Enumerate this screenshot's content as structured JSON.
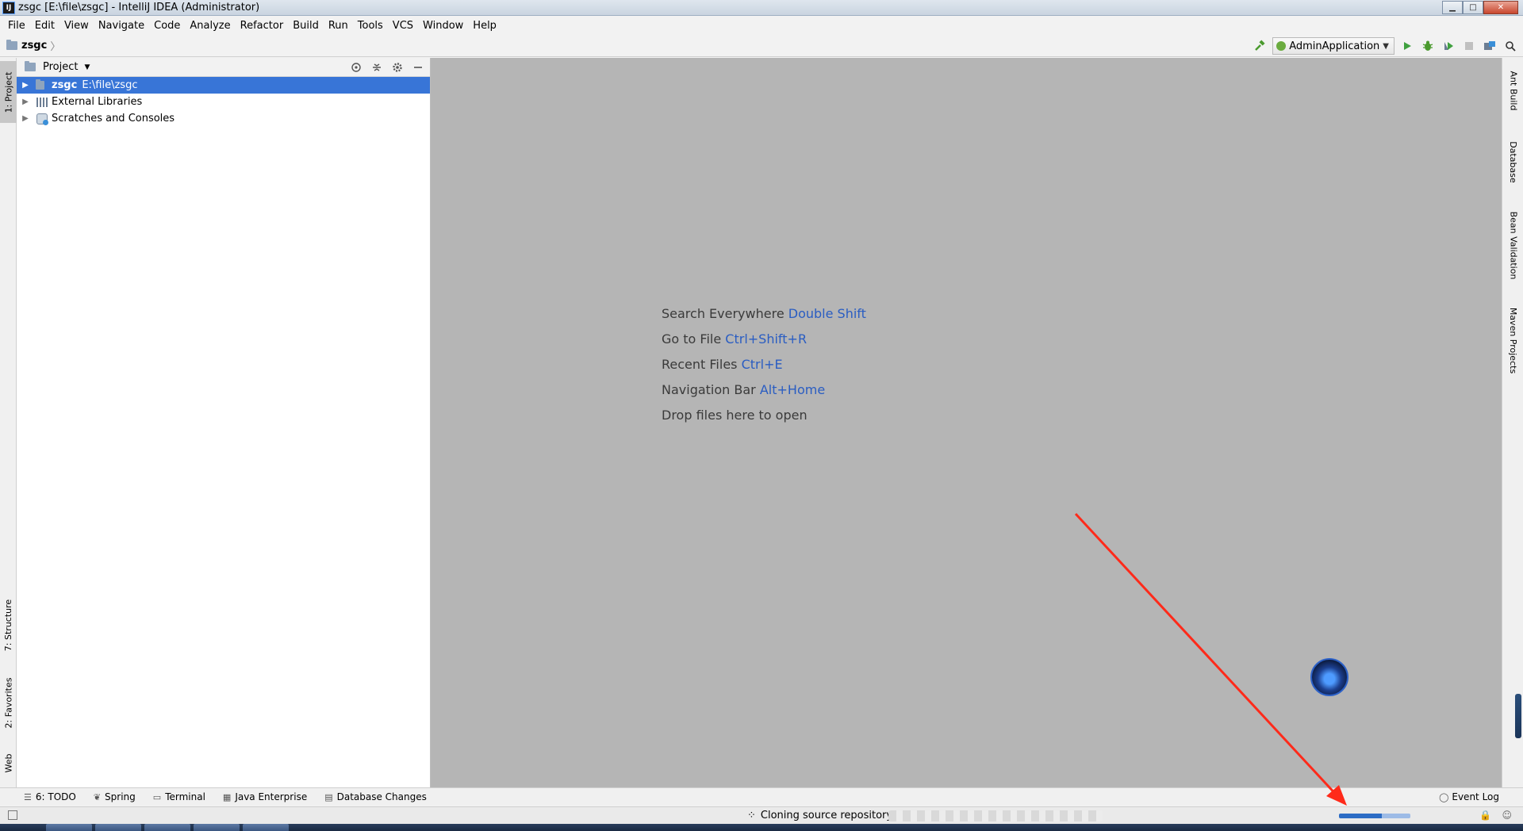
{
  "window": {
    "title": "zsgc [E:\\file\\zsgc] - IntelliJ IDEA (Administrator)",
    "app_icon": "IJ"
  },
  "menu": [
    {
      "label": "File"
    },
    {
      "label": "Edit"
    },
    {
      "label": "View"
    },
    {
      "label": "Navigate"
    },
    {
      "label": "Code"
    },
    {
      "label": "Analyze"
    },
    {
      "label": "Refactor"
    },
    {
      "label": "Build"
    },
    {
      "label": "Run"
    },
    {
      "label": "Tools"
    },
    {
      "label": "VCS"
    },
    {
      "label": "Window"
    },
    {
      "label": "Help"
    }
  ],
  "breadcrumb": {
    "project": "zsgc",
    "separator": "〉"
  },
  "toolbar": {
    "run_config": "AdminApplication"
  },
  "left_tabs": {
    "project": "1: Project",
    "structure": "7: Structure",
    "favorites": "2: Favorites",
    "web": "Web"
  },
  "project_panel": {
    "title": "Project",
    "items": [
      {
        "name": "zsgc",
        "path": "E:\\file\\zsgc",
        "selected": true
      },
      {
        "name": "External Libraries"
      },
      {
        "name": "Scratches and Consoles"
      }
    ]
  },
  "editor": {
    "hints": [
      {
        "text": "Search Everywhere",
        "key": "Double Shift"
      },
      {
        "text": "Go to File",
        "key": "Ctrl+Shift+R"
      },
      {
        "text": "Recent Files",
        "key": "Ctrl+E"
      },
      {
        "text": "Navigation Bar",
        "key": "Alt+Home"
      },
      {
        "text": "Drop files here to open",
        "key": ""
      }
    ]
  },
  "right_tabs": {
    "ant": "Ant Build",
    "database": "Database",
    "bean": "Bean Validation",
    "maven": "Maven Projects"
  },
  "bottom_tabs": {
    "todo": "6: TODO",
    "spring": "Spring",
    "terminal": "Terminal",
    "java_enterprise": "Java Enterprise",
    "db_changes": "Database Changes",
    "event_log": "Event Log"
  },
  "status": {
    "message": "Cloning source repository"
  },
  "colors": {
    "selection": "#3875d7",
    "editor_bg": "#b5b5b5",
    "hint_key": "#2a5dc2",
    "annotation_arrow": "#ff2a1a"
  }
}
